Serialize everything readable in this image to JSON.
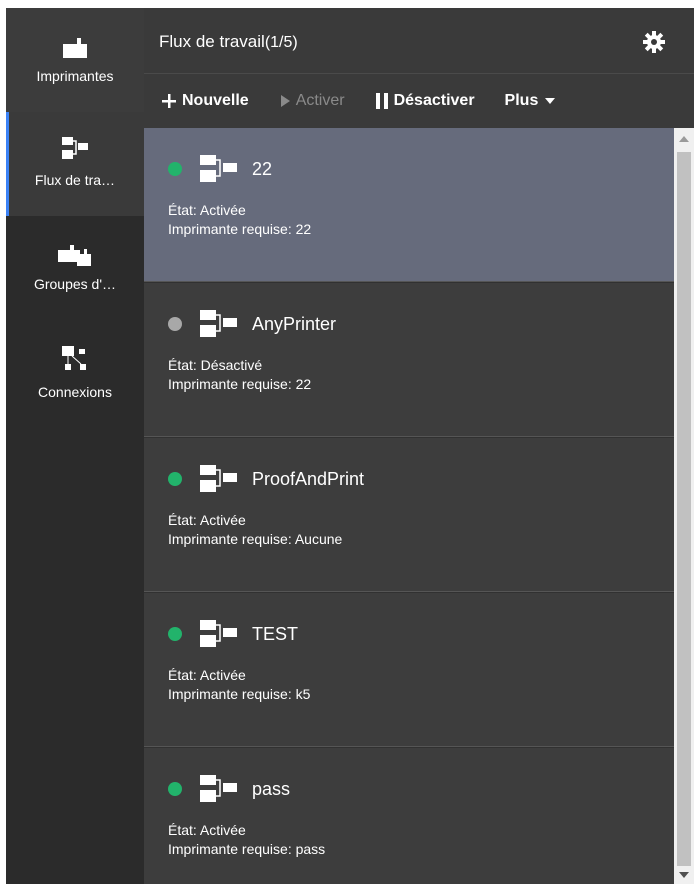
{
  "sidebar": {
    "items": [
      {
        "label": "Imprimantes",
        "icon": "printer-icon"
      },
      {
        "label": "Flux de tra…",
        "icon": "workflow-icon"
      },
      {
        "label": "Groupes d'…",
        "icon": "printer-group-icon"
      },
      {
        "label": "Connexions",
        "icon": "connections-icon"
      }
    ],
    "active_index": 1,
    "accent_color": "#3b82f6"
  },
  "header": {
    "title": "Flux de travail",
    "count": "(1/5)",
    "settings_icon": "gear-icon"
  },
  "toolbar": {
    "new_label": "Nouvelle",
    "activate_label": "Activer",
    "deactivate_label": "Désactiver",
    "more_label": "Plus"
  },
  "workflows": [
    {
      "name": "22",
      "state": "État: Activée",
      "printer": "Imprimante requise: 22",
      "active": true,
      "selected": true
    },
    {
      "name": "AnyPrinter",
      "state": "État: Désactivé",
      "printer": "Imprimante requise: 22",
      "active": false,
      "selected": false
    },
    {
      "name": "ProofAndPrint",
      "state": "État: Activée",
      "printer": "Imprimante requise: Aucune",
      "active": true,
      "selected": false
    },
    {
      "name": "TEST",
      "state": "État: Activée",
      "printer": "Imprimante requise: k5",
      "active": true,
      "selected": false
    },
    {
      "name": "pass",
      "state": "État: Activée",
      "printer": "Imprimante requise: pass",
      "active": true,
      "selected": false
    }
  ],
  "colors": {
    "status_active": "#22b36b",
    "status_inactive": "#a8a8a8",
    "selected_bg": "#666b7c"
  }
}
